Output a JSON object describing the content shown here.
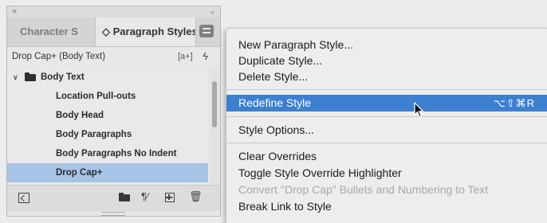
{
  "panel": {
    "close_glyph": "×",
    "collapse_glyph": "‹‹",
    "tabs": [
      {
        "label": "Character S"
      },
      {
        "label": "◇ Paragraph Styles"
      }
    ],
    "status_label": "Drop Cap+ (Body Text)",
    "status_icons": {
      "override": "[a+]",
      "lightning": "ϟ"
    },
    "group": {
      "label": "Body Text",
      "expand_glyph": "∨"
    },
    "items": [
      {
        "label": "Location Pull-outs"
      },
      {
        "label": "Body Head"
      },
      {
        "label": "Body Paragraphs"
      },
      {
        "label": "Body Paragraphs No Indent"
      },
      {
        "label": "Drop Cap+"
      }
    ],
    "bottom_icons": {
      "clear_overrides": "¶⁄",
      "delete": "🗑"
    }
  },
  "menu": {
    "items": [
      {
        "label": "New Paragraph Style..."
      },
      {
        "label": "Duplicate Style..."
      },
      {
        "label": "Delete Style..."
      },
      {
        "label": "Redefine Style",
        "shortcut": "⌥⇧⌘R"
      },
      {
        "label": "Style Options..."
      },
      {
        "label": "Clear Overrides"
      },
      {
        "label": "Toggle Style Override Highlighter"
      },
      {
        "label": "Convert \"Drop Cap\" Bullets and Numbering to Text"
      },
      {
        "label": "Break Link to Style"
      }
    ]
  },
  "colors": {
    "selection": "#a6c4e6",
    "menu_highlight": "#3d7fd0"
  }
}
